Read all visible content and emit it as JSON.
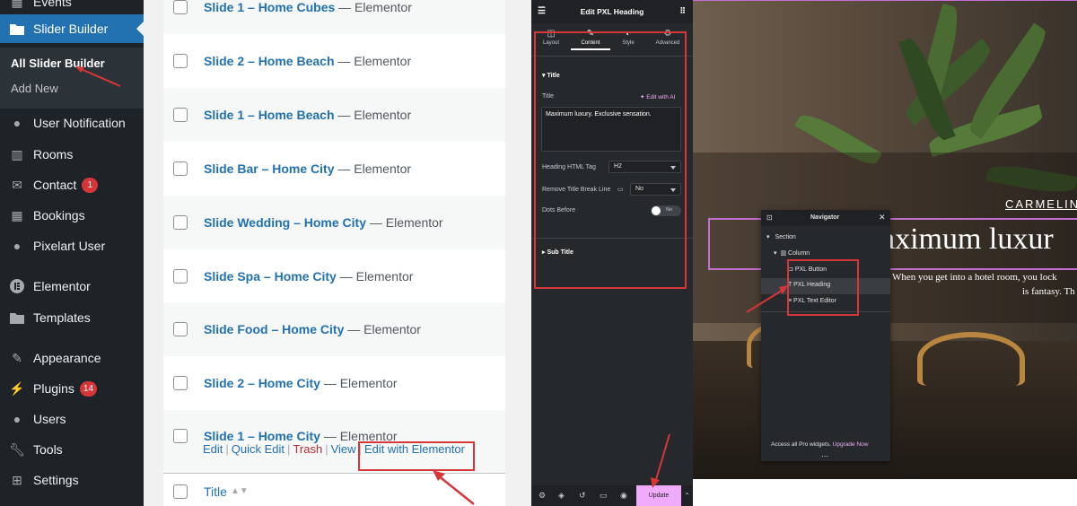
{
  "sidebar": {
    "items": [
      {
        "label": "Events",
        "icon": "calendar-icon"
      },
      {
        "label": "Slider Builder",
        "icon": "folder-icon"
      },
      {
        "label": "User Notification",
        "icon": "user-icon"
      },
      {
        "label": "Rooms",
        "icon": "building-icon"
      },
      {
        "label": "Contact",
        "icon": "mail-icon",
        "badge": "1"
      },
      {
        "label": "Bookings",
        "icon": "calendar-icon"
      },
      {
        "label": "Pixelart User",
        "icon": "user-icon"
      },
      {
        "label": "Elementor",
        "icon": "elementor-icon"
      },
      {
        "label": "Templates",
        "icon": "folder-icon"
      },
      {
        "label": "Appearance",
        "icon": "brush-icon"
      },
      {
        "label": "Plugins",
        "icon": "plug-icon",
        "badge": "14"
      },
      {
        "label": "Users",
        "icon": "user-icon"
      },
      {
        "label": "Tools",
        "icon": "wrench-icon"
      },
      {
        "label": "Settings",
        "icon": "settings-icon"
      }
    ],
    "submenu": {
      "all": "All Slider Builder",
      "add": "Add New"
    }
  },
  "list": {
    "suffix": " — Elementor",
    "rows": [
      {
        "title": "Slide 1 – Home Cubes"
      },
      {
        "title": "Slide 2 – Home Beach"
      },
      {
        "title": "Slide 1 – Home Beach"
      },
      {
        "title": "Slide Bar – Home City"
      },
      {
        "title": "Slide Wedding – Home City"
      },
      {
        "title": "Slide Spa – Home City"
      },
      {
        "title": "Slide Food – Home City"
      },
      {
        "title": "Slide 2 – Home City"
      },
      {
        "title": "Slide 1 – Home City"
      }
    ],
    "actions": {
      "edit": "Edit",
      "quick": "Quick Edit",
      "trash": "Trash",
      "view": "View",
      "elementor": "Edit with Elementor"
    },
    "footer_col": "Title"
  },
  "editor": {
    "title": "Edit PXL Heading",
    "tabs": [
      "Layout",
      "Content",
      "Style",
      "Advanced"
    ],
    "section_title": "Title",
    "title_label": "Title",
    "ai_label": "Edit with AI",
    "title_value": "Maximum luxury. Exclusive sensation.",
    "heading_tag_label": "Heading HTML Tag",
    "heading_tag": "H2",
    "break_label": "Remove Title Break Line",
    "break_value": "No",
    "dots_label": "Dots Before",
    "dots_value": "No",
    "sub_title": "Sub Title",
    "update": "Update"
  },
  "preview": {
    "brand": "CARMELINA",
    "heading": "aximum luxur",
    "text1": "When you get into a hotel room, you lock",
    "text2": "is fantasy. Th"
  },
  "navigator": {
    "title": "Navigator",
    "section": "Section",
    "column": "Column",
    "items": [
      "PXL Button",
      "PXL Heading",
      "PXL Text Editor"
    ],
    "footer": "Access all Pro widgets.",
    "upgrade": "Upgrade Now"
  },
  "colors": {
    "wp_blue": "#2271b1",
    "annot_red": "#d63638",
    "elementor_pink": "#f0abfc"
  }
}
